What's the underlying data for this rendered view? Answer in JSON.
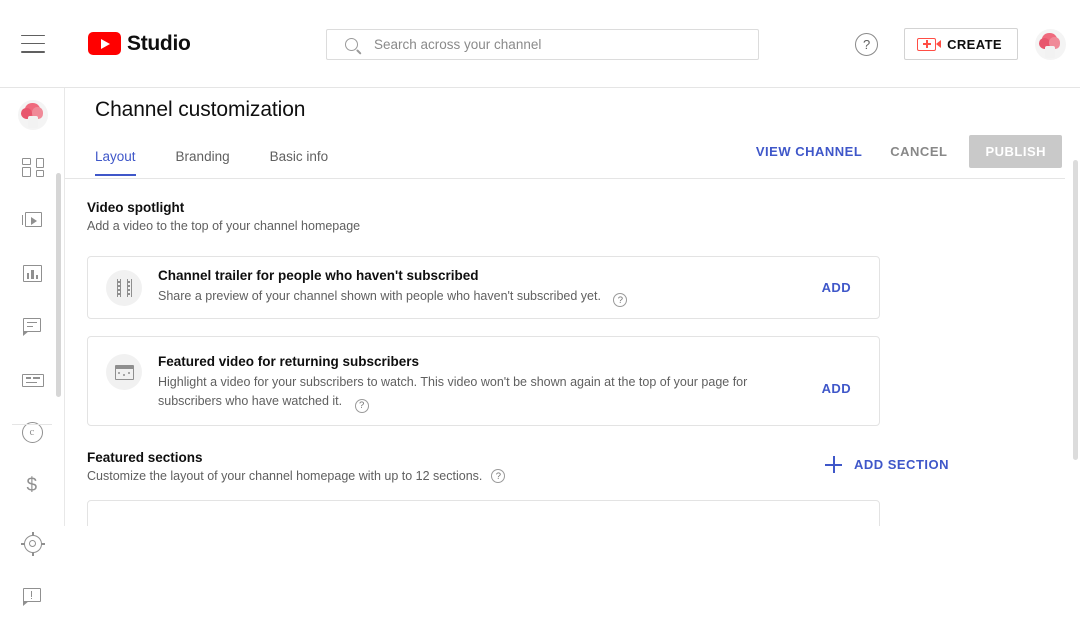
{
  "header": {
    "menu_icon": "hamburger-icon",
    "brand": "Studio",
    "logo_icon": "youtube-logo-icon",
    "search": {
      "placeholder": "Search across your channel",
      "value": "",
      "icon": "search-icon"
    },
    "help_icon": "question-mark-icon",
    "create": {
      "label": "CREATE",
      "icon": "video-camera-plus-icon"
    },
    "avatar": "channel-avatar"
  },
  "sidebar": {
    "avatar": "channel-avatar",
    "items": [
      {
        "name": "dashboard",
        "icon": "dashboard-grid-icon"
      },
      {
        "name": "content",
        "icon": "video-play-icon"
      },
      {
        "name": "analytics",
        "icon": "bar-chart-icon"
      },
      {
        "name": "comments",
        "icon": "comment-bubble-icon"
      },
      {
        "name": "subtitles",
        "icon": "subtitles-icon"
      },
      {
        "name": "copyright",
        "icon": "copyright-circle-icon"
      },
      {
        "name": "earn",
        "icon": "dollar-sign-icon"
      },
      {
        "name": "settings",
        "icon": "gear-icon"
      },
      {
        "name": "send-feedback",
        "icon": "feedback-exclamation-icon"
      }
    ]
  },
  "main": {
    "page_title": "Channel customization",
    "tabs": [
      {
        "label": "Layout",
        "active": true
      },
      {
        "label": "Branding",
        "active": false
      },
      {
        "label": "Basic info",
        "active": false
      }
    ],
    "actions": {
      "view_channel": "VIEW CHANNEL",
      "cancel": "CANCEL",
      "publish": "PUBLISH",
      "publish_disabled": true
    },
    "video_spotlight": {
      "title": "Video spotlight",
      "subtitle": "Add a video to the top of your channel homepage",
      "cards": [
        {
          "icon": "film-strip-icon",
          "title": "Channel trailer for people who haven't subscribed",
          "description": "Share a preview of your channel shown with people who haven't subscribed yet.",
          "help_icon": "question-mark-icon",
          "action": "ADD"
        },
        {
          "icon": "featured-video-icon",
          "title": "Featured video for returning subscribers",
          "description": "Highlight a video for your subscribers to watch. This video won't be shown again at the top of your page for subscribers who have watched it.",
          "help_icon": "question-mark-icon",
          "action": "ADD"
        }
      ]
    },
    "featured_sections": {
      "title": "Featured sections",
      "subtitle": "Customize the layout of your channel homepage with up to 12 sections.",
      "help_icon": "question-mark-icon",
      "add_section": {
        "label": "ADD SECTION",
        "icon": "plus-icon"
      }
    }
  },
  "colors": {
    "accent_blue": "#3f57c9",
    "brand_red": "#ff0000",
    "create_icon_red": "#ff4e45",
    "text_primary": "#0f0f0f",
    "text_secondary": "#606060",
    "disabled_gray": "#c9c9c9",
    "border": "#e3e3e3"
  }
}
